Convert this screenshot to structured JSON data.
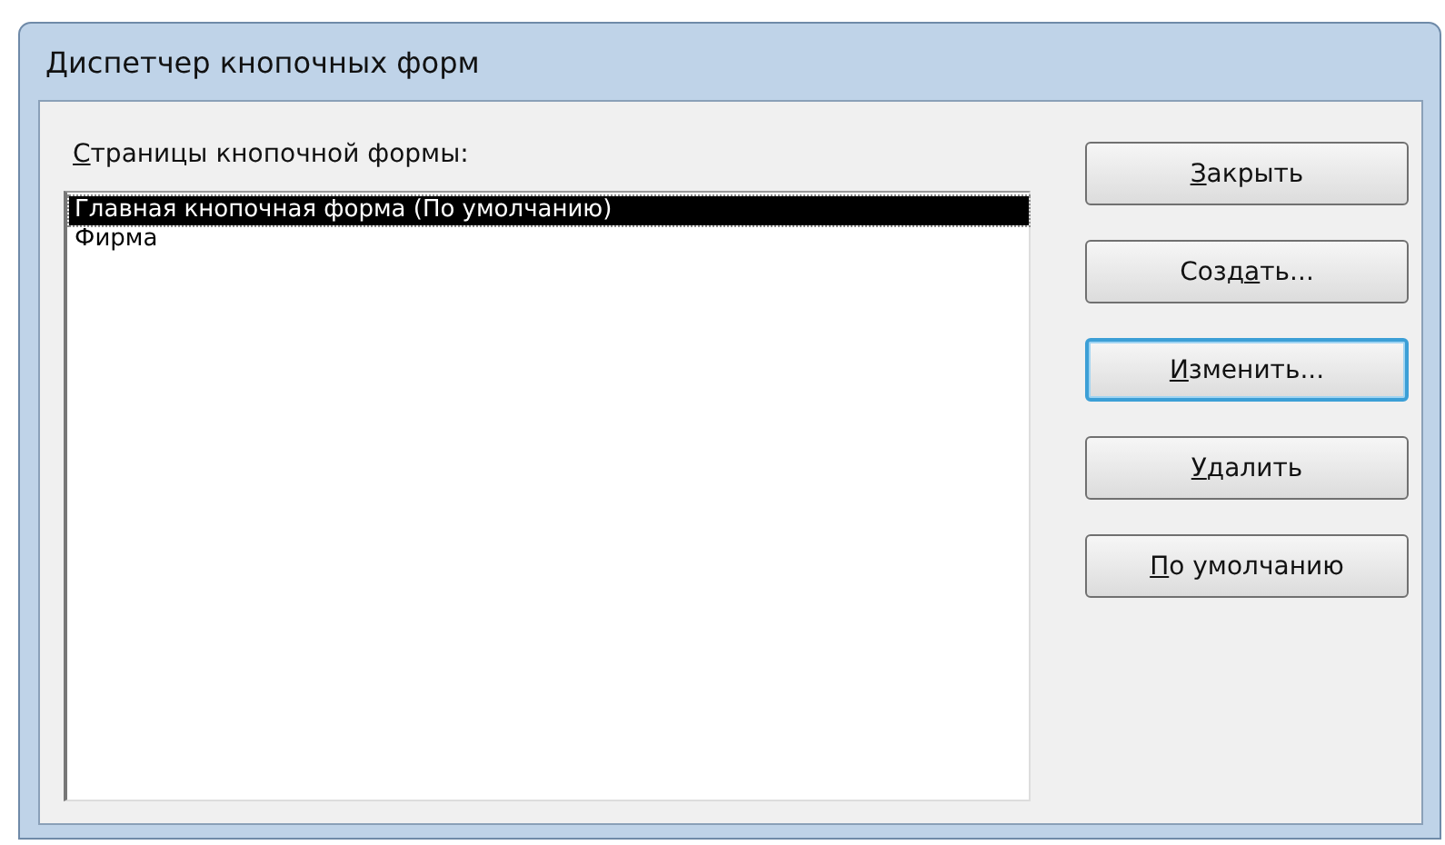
{
  "window": {
    "title": "Диспетчер кнопочных форм"
  },
  "pages_label": {
    "access_key": "С",
    "label_end": "траницы кнопочной формы:"
  },
  "pages": [
    {
      "label": "Главная кнопочная форма (По умолчанию)",
      "selected": true
    },
    {
      "label": "Фирма",
      "selected": false
    }
  ],
  "buttons": [
    {
      "access_key": "З",
      "label_end": "акрыть",
      "focused": false
    },
    {
      "label_start": "Созд",
      "access_key": "а",
      "label_end": "ть...",
      "focused": false
    },
    {
      "access_key": "И",
      "label_end": "зменить...",
      "focused": true
    },
    {
      "access_key": "У",
      "label_end": "далить",
      "focused": false
    },
    {
      "access_key": "П",
      "label_end": "о умолчанию",
      "focused": false
    }
  ]
}
